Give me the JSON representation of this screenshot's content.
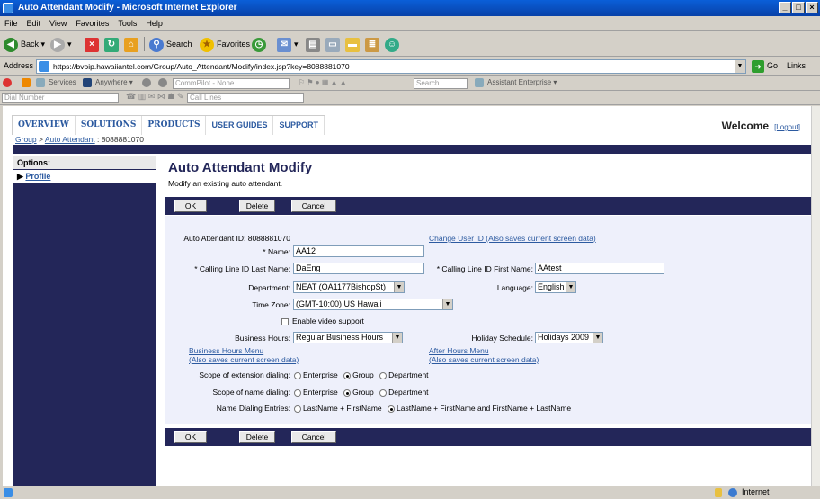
{
  "window": {
    "title": "Auto Attendant Modify - Microsoft Internet Explorer"
  },
  "menu": [
    "File",
    "Edit",
    "View",
    "Favorites",
    "Tools",
    "Help"
  ],
  "toolbar": {
    "back": "Back",
    "search": "Search",
    "favorites": "Favorites"
  },
  "address": {
    "label": "Address",
    "url": "https://bvoip.hawaiiantel.com/Group/Auto_Attendant/Modify/index.jsp?key=8088881070",
    "go": "Go",
    "links": "Links"
  },
  "toolbar2": {
    "services": "Services",
    "anywhere": "Anywhere",
    "commpilot": "CommPilot - None",
    "search": "Search",
    "assistant": "Assistant Enterprise"
  },
  "toolbar3": {
    "dial": "Dial Number",
    "calllines": "Call Lines"
  },
  "nav": {
    "tabs": [
      "OVERVIEW",
      "SOLUTIONS",
      "PRODUCTS",
      "USER GUIDES",
      "SUPPORT"
    ],
    "welcome": "Welcome",
    "logout": "[Logout]"
  },
  "breadcrumb": {
    "group": "Group",
    "sep": " > ",
    "aa": "Auto Attendant",
    "rest": " : 8088881070"
  },
  "sidebar": {
    "options": "Options:",
    "profile": "Profile"
  },
  "page": {
    "title": "Auto Attendant Modify",
    "subtitle": "Modify an existing auto attendant."
  },
  "buttons": {
    "ok": "OK",
    "delete": "Delete",
    "cancel": "Cancel"
  },
  "form": {
    "aa_id_label": "Auto Attendant ID:",
    "aa_id": "8088881070",
    "change_user": "Change User ID (Also saves current screen data)",
    "name_label": "* Name:",
    "name": "AA12",
    "clid_last_label": "* Calling Line ID Last Name:",
    "clid_last": "DaEng",
    "clid_first_label": "* Calling Line ID First Name:",
    "clid_first": "AAtest",
    "dept_label": "Department:",
    "dept": "NEAT (OA1177BishopSt)",
    "lang_label": "Language:",
    "lang": "English",
    "tz_label": "Time Zone:",
    "tz": "(GMT-10:00) US Hawaii",
    "video": "Enable video support",
    "bh_label": "Business Hours:",
    "bh": "Regular Business Hours",
    "hs_label": "Holiday Schedule:",
    "hs": "Holidays 2009",
    "bh_menu": "Business Hours Menu",
    "bh_menu2": "(Also saves current screen data)",
    "ah_menu": "After Hours Menu",
    "ah_menu2": "(Also saves current screen data)",
    "ext_label": "Scope of extension dialing:",
    "name_scope_label": "Scope of name dialing:",
    "opt_enterprise": "Enterprise",
    "opt_group": "Group",
    "opt_department": "Department",
    "nde_label": "Name Dialing Entries:",
    "nde_opt1": "LastName + FirstName",
    "nde_opt2": "LastName + FirstName and FirstName + LastName"
  },
  "status": {
    "zone": "Internet"
  }
}
